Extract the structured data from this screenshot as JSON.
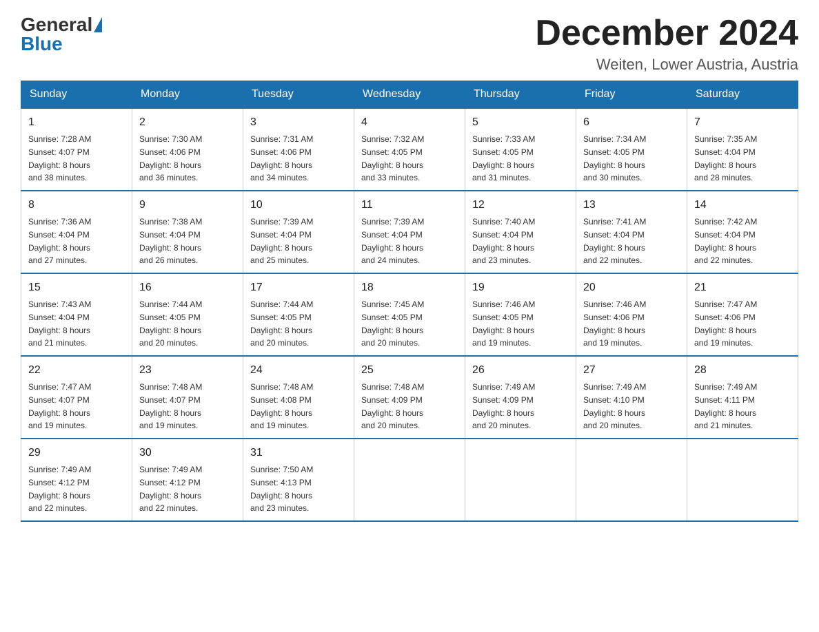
{
  "logo": {
    "general": "General",
    "blue": "Blue"
  },
  "header": {
    "month": "December 2024",
    "location": "Weiten, Lower Austria, Austria"
  },
  "weekdays": [
    "Sunday",
    "Monday",
    "Tuesday",
    "Wednesday",
    "Thursday",
    "Friday",
    "Saturday"
  ],
  "weeks": [
    [
      {
        "day": "1",
        "sunrise": "7:28 AM",
        "sunset": "4:07 PM",
        "daylight": "8 hours and 38 minutes."
      },
      {
        "day": "2",
        "sunrise": "7:30 AM",
        "sunset": "4:06 PM",
        "daylight": "8 hours and 36 minutes."
      },
      {
        "day": "3",
        "sunrise": "7:31 AM",
        "sunset": "4:06 PM",
        "daylight": "8 hours and 34 minutes."
      },
      {
        "day": "4",
        "sunrise": "7:32 AM",
        "sunset": "4:05 PM",
        "daylight": "8 hours and 33 minutes."
      },
      {
        "day": "5",
        "sunrise": "7:33 AM",
        "sunset": "4:05 PM",
        "daylight": "8 hours and 31 minutes."
      },
      {
        "day": "6",
        "sunrise": "7:34 AM",
        "sunset": "4:05 PM",
        "daylight": "8 hours and 30 minutes."
      },
      {
        "day": "7",
        "sunrise": "7:35 AM",
        "sunset": "4:04 PM",
        "daylight": "8 hours and 28 minutes."
      }
    ],
    [
      {
        "day": "8",
        "sunrise": "7:36 AM",
        "sunset": "4:04 PM",
        "daylight": "8 hours and 27 minutes."
      },
      {
        "day": "9",
        "sunrise": "7:38 AM",
        "sunset": "4:04 PM",
        "daylight": "8 hours and 26 minutes."
      },
      {
        "day": "10",
        "sunrise": "7:39 AM",
        "sunset": "4:04 PM",
        "daylight": "8 hours and 25 minutes."
      },
      {
        "day": "11",
        "sunrise": "7:39 AM",
        "sunset": "4:04 PM",
        "daylight": "8 hours and 24 minutes."
      },
      {
        "day": "12",
        "sunrise": "7:40 AM",
        "sunset": "4:04 PM",
        "daylight": "8 hours and 23 minutes."
      },
      {
        "day": "13",
        "sunrise": "7:41 AM",
        "sunset": "4:04 PM",
        "daylight": "8 hours and 22 minutes."
      },
      {
        "day": "14",
        "sunrise": "7:42 AM",
        "sunset": "4:04 PM",
        "daylight": "8 hours and 22 minutes."
      }
    ],
    [
      {
        "day": "15",
        "sunrise": "7:43 AM",
        "sunset": "4:04 PM",
        "daylight": "8 hours and 21 minutes."
      },
      {
        "day": "16",
        "sunrise": "7:44 AM",
        "sunset": "4:05 PM",
        "daylight": "8 hours and 20 minutes."
      },
      {
        "day": "17",
        "sunrise": "7:44 AM",
        "sunset": "4:05 PM",
        "daylight": "8 hours and 20 minutes."
      },
      {
        "day": "18",
        "sunrise": "7:45 AM",
        "sunset": "4:05 PM",
        "daylight": "8 hours and 20 minutes."
      },
      {
        "day": "19",
        "sunrise": "7:46 AM",
        "sunset": "4:05 PM",
        "daylight": "8 hours and 19 minutes."
      },
      {
        "day": "20",
        "sunrise": "7:46 AM",
        "sunset": "4:06 PM",
        "daylight": "8 hours and 19 minutes."
      },
      {
        "day": "21",
        "sunrise": "7:47 AM",
        "sunset": "4:06 PM",
        "daylight": "8 hours and 19 minutes."
      }
    ],
    [
      {
        "day": "22",
        "sunrise": "7:47 AM",
        "sunset": "4:07 PM",
        "daylight": "8 hours and 19 minutes."
      },
      {
        "day": "23",
        "sunrise": "7:48 AM",
        "sunset": "4:07 PM",
        "daylight": "8 hours and 19 minutes."
      },
      {
        "day": "24",
        "sunrise": "7:48 AM",
        "sunset": "4:08 PM",
        "daylight": "8 hours and 19 minutes."
      },
      {
        "day": "25",
        "sunrise": "7:48 AM",
        "sunset": "4:09 PM",
        "daylight": "8 hours and 20 minutes."
      },
      {
        "day": "26",
        "sunrise": "7:49 AM",
        "sunset": "4:09 PM",
        "daylight": "8 hours and 20 minutes."
      },
      {
        "day": "27",
        "sunrise": "7:49 AM",
        "sunset": "4:10 PM",
        "daylight": "8 hours and 20 minutes."
      },
      {
        "day": "28",
        "sunrise": "7:49 AM",
        "sunset": "4:11 PM",
        "daylight": "8 hours and 21 minutes."
      }
    ],
    [
      {
        "day": "29",
        "sunrise": "7:49 AM",
        "sunset": "4:12 PM",
        "daylight": "8 hours and 22 minutes."
      },
      {
        "day": "30",
        "sunrise": "7:49 AM",
        "sunset": "4:12 PM",
        "daylight": "8 hours and 22 minutes."
      },
      {
        "day": "31",
        "sunrise": "7:50 AM",
        "sunset": "4:13 PM",
        "daylight": "8 hours and 23 minutes."
      },
      null,
      null,
      null,
      null
    ]
  ],
  "labels": {
    "sunrise": "Sunrise: ",
    "sunset": "Sunset: ",
    "daylight": "Daylight: "
  }
}
